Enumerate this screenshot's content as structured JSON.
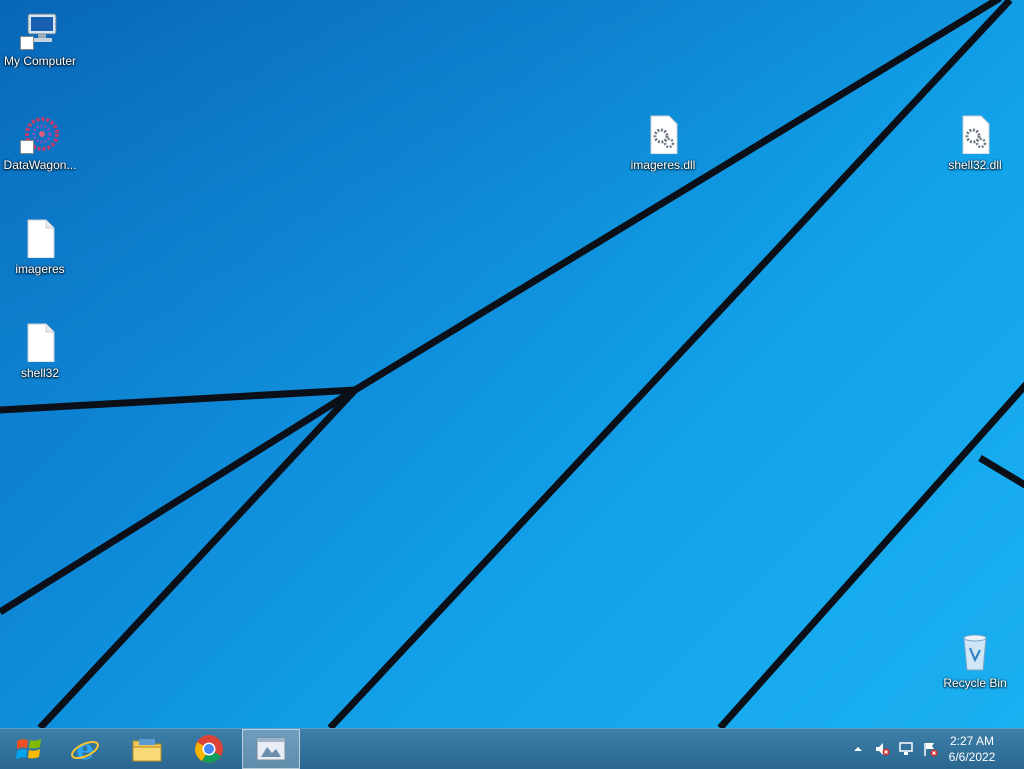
{
  "desktop": {
    "icons": [
      {
        "label": "My Computer",
        "icon": "computer-icon"
      },
      {
        "label": "DataWagon...",
        "icon": "datawagon-icon"
      },
      {
        "label": "imageres",
        "icon": "blank-file-icon"
      },
      {
        "label": "shell32",
        "icon": "blank-file-icon"
      },
      {
        "label": "imageres.dll",
        "icon": "dll-file-icon"
      },
      {
        "label": "shell32.dll",
        "icon": "dll-file-icon"
      },
      {
        "label": "Recycle Bin",
        "icon": "recycle-bin-icon"
      }
    ]
  },
  "taskbar": {
    "apps": [
      {
        "name": "start",
        "icon": "windows-logo-icon"
      },
      {
        "name": "internet-explorer",
        "icon": "internet-explorer-icon"
      },
      {
        "name": "file-explorer",
        "icon": "folder-icon"
      },
      {
        "name": "chrome",
        "icon": "chrome-icon"
      },
      {
        "name": "active-app",
        "icon": "app-window-icon"
      }
    ],
    "clock": {
      "time": "2:27 AM",
      "date": "6/6/2022"
    }
  },
  "colors": {
    "accent": "#12a3ea",
    "taskbar": "#2a6790"
  }
}
